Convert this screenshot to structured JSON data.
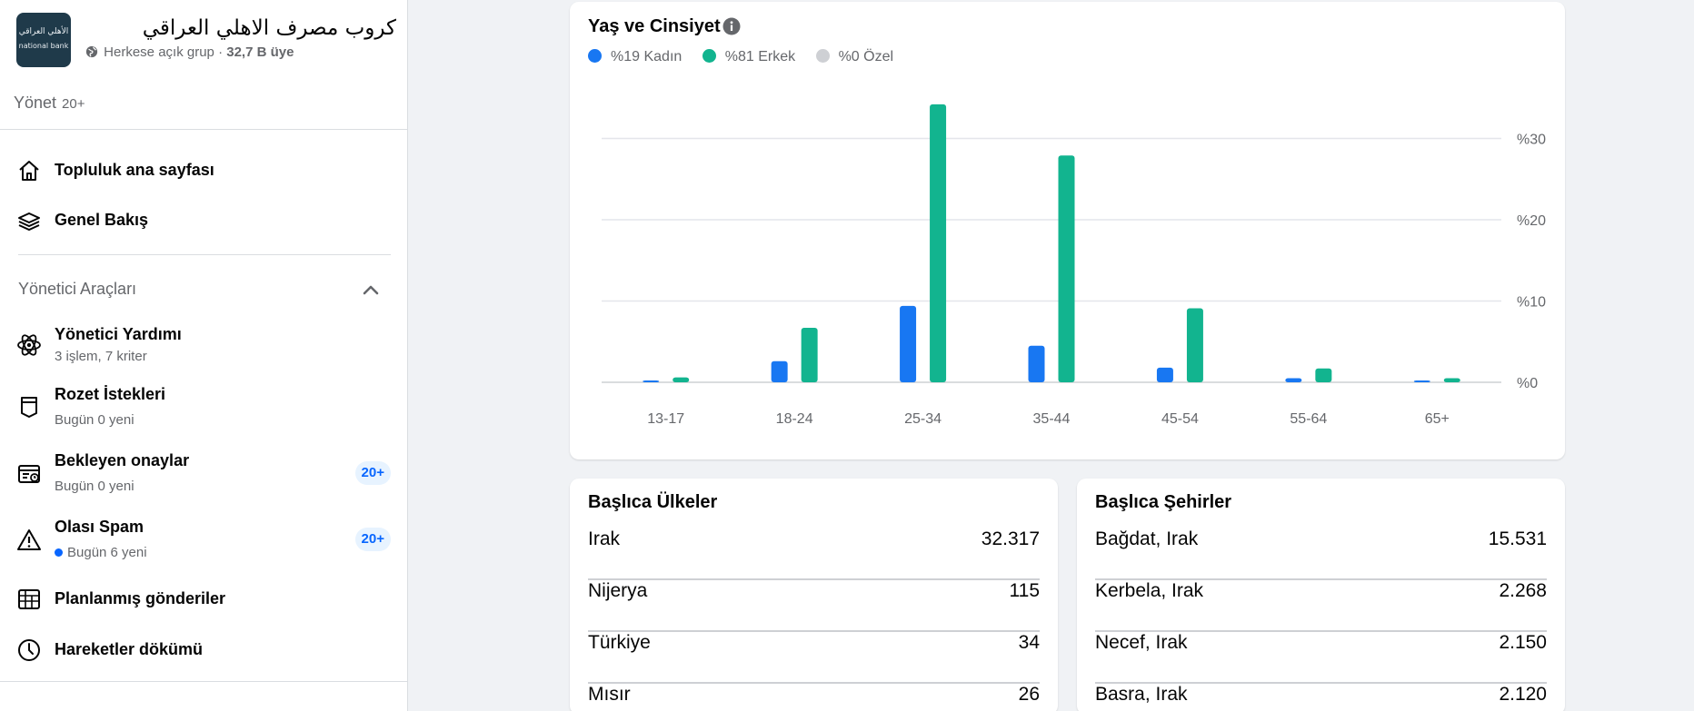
{
  "sidebar": {
    "group_name": "كروب مصرف الاهلي العراقي",
    "group_privacy": "Herkese açık grup",
    "group_members": "32,7 B üye",
    "logo_text_ar": "الأهلي العراقي",
    "logo_text_en": "national bank",
    "manage_label": "Yönet",
    "manage_count": "20+",
    "nav": [
      {
        "label": "Topluluk ana sayfası",
        "icon": "home-icon"
      },
      {
        "label": "Genel Bakış",
        "icon": "layers-icon"
      }
    ],
    "admin_tools_title": "Yönetici Araçları",
    "admin_items": [
      {
        "label": "Yönetici Yardımı",
        "sub": "3 işlem, 7 kriter",
        "icon": "atom-icon"
      },
      {
        "label": "Rozet İstekleri",
        "sub": "Bugün 0 yeni",
        "icon": "badge-shield-icon"
      },
      {
        "label": "Bekleyen onaylar",
        "sub": "Bugün 0 yeni",
        "badge": "20+",
        "icon": "pending-approvals-icon"
      },
      {
        "label": "Olası Spam",
        "sub": "Bugün 6 yeni",
        "badge": "20+",
        "icon": "warning-icon"
      },
      {
        "label": "Planlanmış gönderiler",
        "icon": "calendar-grid-icon"
      },
      {
        "label": "Hareketler dökümü",
        "icon": "clock-icon"
      }
    ]
  },
  "chart_card": {
    "title": "Yaş ve Cinsiyet"
  },
  "chart_data": {
    "type": "bar",
    "title": "Yaş ve Cinsiyet",
    "categories": [
      "13-17",
      "18-24",
      "25-34",
      "35-44",
      "45-54",
      "55-64",
      "65+"
    ],
    "series": [
      {
        "name": "%19 Kadın",
        "color": "#1877f2",
        "values": [
          0.2,
          2.6,
          9.4,
          4.5,
          1.8,
          0.5,
          0.2
        ]
      },
      {
        "name": "%81 Erkek",
        "color": "#12b48f",
        "values": [
          0.6,
          6.7,
          34.2,
          27.9,
          9.1,
          1.7,
          0.5
        ]
      },
      {
        "name": "%0 Özel",
        "color": "#ced0d4",
        "values": [
          0,
          0,
          0,
          0,
          0,
          0,
          0
        ]
      }
    ],
    "yticks": [
      "%0",
      "%10",
      "%20",
      "%30"
    ],
    "ylim": [
      0,
      30
    ],
    "xlabel": "",
    "ylabel": "",
    "grid": true,
    "legend_position": "top-left"
  },
  "countries": {
    "title": "Başlıca Ülkeler",
    "rows": [
      {
        "name": "Irak",
        "value": "32.317"
      },
      {
        "name": "Nijerya",
        "value": "115"
      },
      {
        "name": "Türkiye",
        "value": "34"
      },
      {
        "name": "Mısır",
        "value": "26"
      }
    ]
  },
  "cities": {
    "title": "Başlıca Şehirler",
    "rows": [
      {
        "name": "Bağdat, Irak",
        "value": "15.531"
      },
      {
        "name": "Kerbela, Irak",
        "value": "2.268"
      },
      {
        "name": "Necef, Irak",
        "value": "2.150"
      },
      {
        "name": "Basra, Irak",
        "value": "2.120"
      }
    ]
  }
}
